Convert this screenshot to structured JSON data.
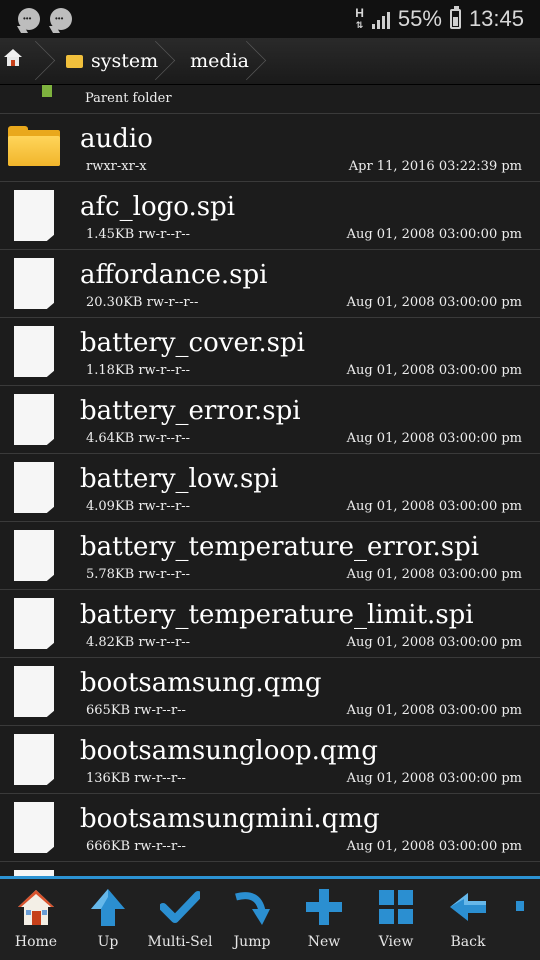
{
  "status_bar": {
    "network": "H",
    "battery": "55%",
    "time": "13:45",
    "icons": [
      "chat-icon",
      "chat-icon"
    ]
  },
  "breadcrumb": {
    "items": [
      "system",
      "media"
    ]
  },
  "parent_folder_label": "Parent folder",
  "files": [
    {
      "name": "audio",
      "meta": "rwxr-xr-x",
      "date": "Apr 11, 2016 03:22:39 pm",
      "type": "folder"
    },
    {
      "name": "afc_logo.spi",
      "meta": "1.45KB rw-r--r--",
      "date": "Aug 01, 2008 03:00:00 pm",
      "type": "file"
    },
    {
      "name": "affordance.spi",
      "meta": "20.30KB rw-r--r--",
      "date": "Aug 01, 2008 03:00:00 pm",
      "type": "file"
    },
    {
      "name": "battery_cover.spi",
      "meta": "1.18KB rw-r--r--",
      "date": "Aug 01, 2008 03:00:00 pm",
      "type": "file"
    },
    {
      "name": "battery_error.spi",
      "meta": "4.64KB rw-r--r--",
      "date": "Aug 01, 2008 03:00:00 pm",
      "type": "file"
    },
    {
      "name": "battery_low.spi",
      "meta": "4.09KB rw-r--r--",
      "date": "Aug 01, 2008 03:00:00 pm",
      "type": "file"
    },
    {
      "name": "battery_temperature_error.spi",
      "meta": "5.78KB rw-r--r--",
      "date": "Aug 01, 2008 03:00:00 pm",
      "type": "file"
    },
    {
      "name": "battery_temperature_limit.spi",
      "meta": "4.82KB rw-r--r--",
      "date": "Aug 01, 2008 03:00:00 pm",
      "type": "file"
    },
    {
      "name": "bootsamsung.qmg",
      "meta": "665KB rw-r--r--",
      "date": "Aug 01, 2008 03:00:00 pm",
      "type": "file"
    },
    {
      "name": "bootsamsungloop.qmg",
      "meta": "136KB rw-r--r--",
      "date": "Aug 01, 2008 03:00:00 pm",
      "type": "file"
    },
    {
      "name": "bootsamsungmini.qmg",
      "meta": "666KB rw-r--r--",
      "date": "Aug 01, 2008 03:00:00 pm",
      "type": "file"
    }
  ],
  "toolbar": {
    "buttons": [
      {
        "label": "Home",
        "icon": "home-icon"
      },
      {
        "label": "Up",
        "icon": "up-arrow-icon"
      },
      {
        "label": "Multi-Sel",
        "icon": "checkmark-icon"
      },
      {
        "label": "Jump",
        "icon": "jump-arrow-icon"
      },
      {
        "label": "New",
        "icon": "plus-icon"
      },
      {
        "label": "View",
        "icon": "grid-icon"
      },
      {
        "label": "Back",
        "icon": "back-arrow-icon"
      }
    ]
  },
  "colors": {
    "accent": "#2c93d3",
    "folder": "#f1b52b",
    "background": "#1c1c1c"
  }
}
